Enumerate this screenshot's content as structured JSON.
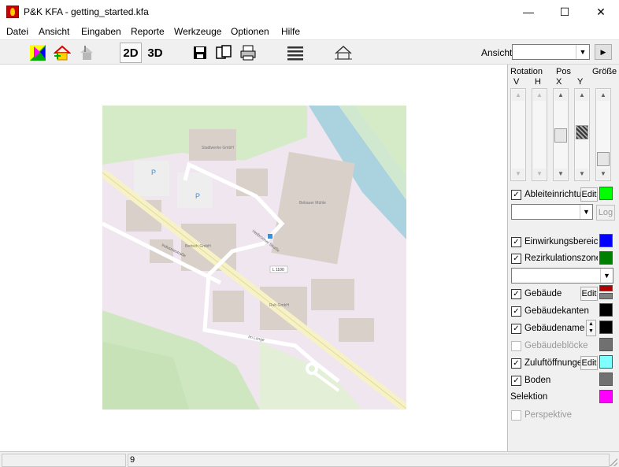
{
  "window": {
    "title": "P&K KFA - getting_started.kfa",
    "minimize_icon": "—",
    "maximize_icon": "☐",
    "close_icon": "✕"
  },
  "menu": [
    "Datei",
    "Ansicht",
    "Eingaben",
    "Reporte",
    "Werkzeuge",
    "Optionen",
    "Hilfe"
  ],
  "toolbar": {
    "btn_2d": "2D",
    "btn_3d": "3D",
    "ansicht_label": "Ansicht:",
    "ansicht_value": ""
  },
  "map": {
    "labels": {
      "street1": "Industriestraße",
      "street2": "Heilbronner Straße",
      "street3": "Im Lange",
      "road_number": "L 1100",
      "building1": "Bertsch GmbH",
      "building2": "Bebauer Mühle",
      "building3": "Ruh GmbH",
      "building4": "Stadtwerke GmbH"
    }
  },
  "sidepanel": {
    "headers": {
      "rotation": "Rotation",
      "pos": "Pos",
      "groesse": "Größe",
      "v": "V",
      "h": "H",
      "x": "X",
      "y": "Y"
    },
    "layers": {
      "ableiteinrichtung": "Ableiteinrichtu",
      "einwirkungsbereich": "Einwirkungsbereich",
      "rezirkulationszone": "Rezirkulationszone",
      "gebaeude": "Gebäude",
      "gebaeudekanten": "Gebäudekanten",
      "gebaeudenamen": "Gebäudenamen",
      "gebaeudebloecke": "Gebäudeblöcke",
      "zuluftoeffnungen": "Zuluftöffnunge",
      "boden": "Boden",
      "selektion": "Selektion",
      "perspektive": "Perspektive"
    },
    "edit_label": "Edit",
    "log_label": "Log",
    "colors": {
      "ableit": "#00ff00",
      "einwirkung": "#0000ff",
      "rezirk": "#008000",
      "gebaeude_top": "#b00000",
      "gebaeude_bottom": "#808080",
      "kanten": "#000000",
      "namen": "#000000",
      "bloecke": "#707070",
      "zuluft": "#80ffff",
      "boden": "#707070",
      "selektion": "#ff00ff"
    }
  },
  "status": {
    "pane1": "",
    "pane2": "9"
  }
}
